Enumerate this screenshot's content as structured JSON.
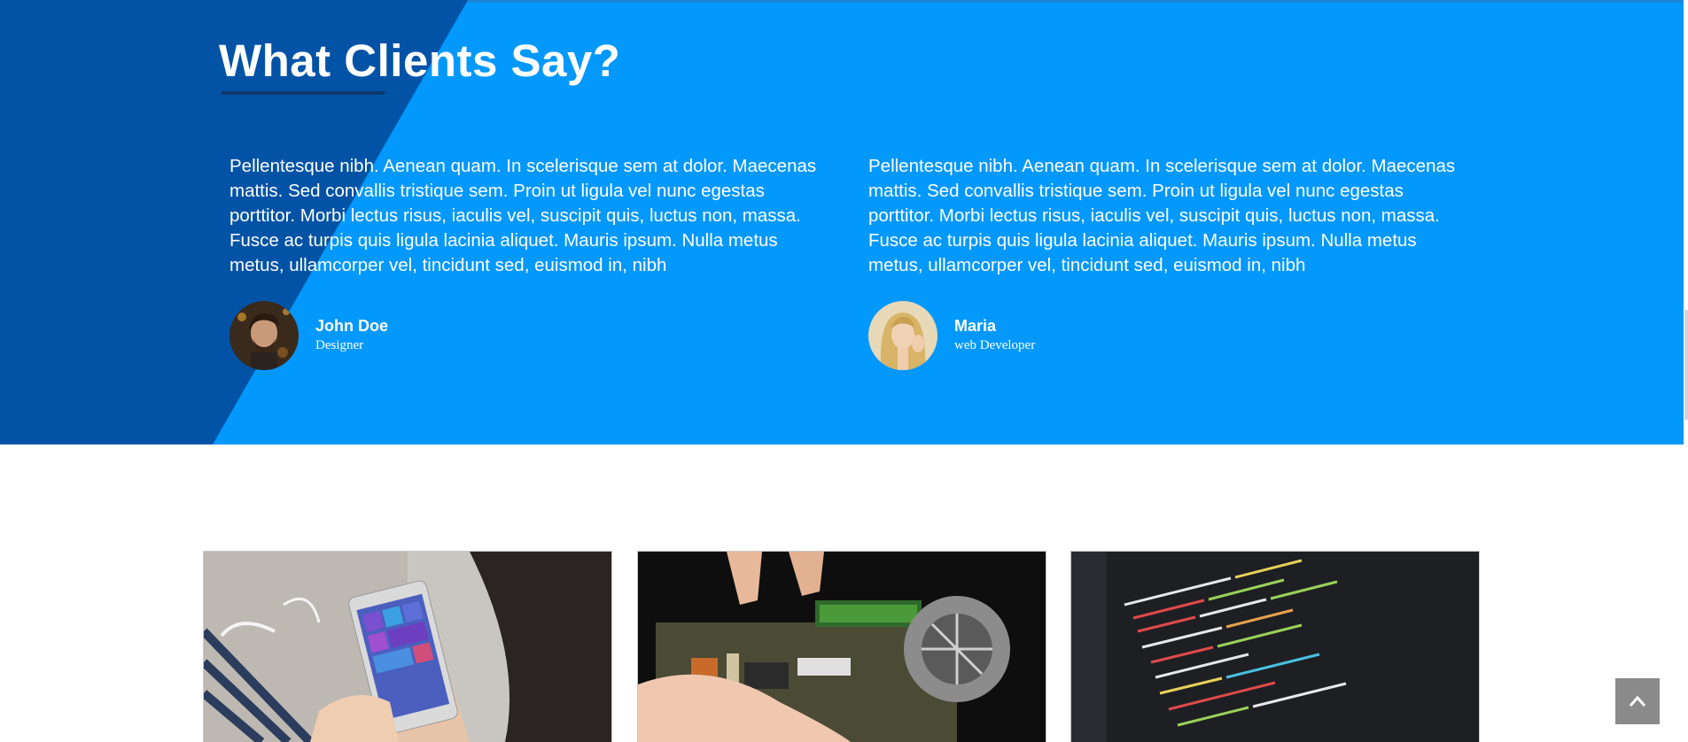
{
  "testimonials": {
    "title": "What Clients Say?",
    "items": [
      {
        "quote": "Pellentesque nibh. Aenean quam. In scelerisque sem at dolor. Maecenas mattis. Sed convallis tristique sem. Proin ut ligula vel nunc egestas porttitor. Morbi lectus risus, iaculis vel, suscipit quis, luctus non, massa. Fusce ac turpis quis ligula lacinia aliquet. Mauris ipsum. Nulla metus metus, ullamcorper vel, tincidunt sed, euismod in, nibh",
        "name": "John Doe",
        "role": "Designer"
      },
      {
        "quote": "Pellentesque nibh. Aenean quam. In scelerisque sem at dolor. Maecenas mattis. Sed convallis tristique sem. Proin ut ligula vel nunc egestas porttitor. Morbi lectus risus, iaculis vel, suscipit quis, luctus non, massa. Fusce ac turpis quis ligula lacinia aliquet. Mauris ipsum. Nulla metus metus, ullamcorper vel, tincidunt sed, euismod in, nibh",
        "name": "Maria",
        "role": "web Developer"
      }
    ]
  },
  "gallery": {
    "tiles": [
      {
        "icon": "smartphone-photo"
      },
      {
        "icon": "circuit-board-photo"
      },
      {
        "icon": "code-screen-photo"
      }
    ]
  },
  "back_to_top": {
    "icon": "chevron-up-icon"
  },
  "colors": {
    "section_bg": "#0298fc",
    "diagonal_bg": "#0253a6",
    "underline": "#0e3768",
    "back_to_top_bg": "#8a8a8a"
  }
}
